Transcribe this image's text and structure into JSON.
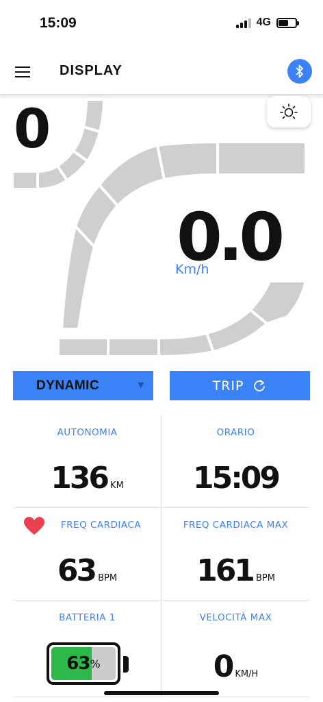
{
  "status": {
    "time": "15:09",
    "network": "4G"
  },
  "header": {
    "title": "DISPLAY"
  },
  "gauge": {
    "assist_level": "0",
    "speed": "0.0",
    "speed_unit": "Km/h"
  },
  "mode": {
    "selected": "DYNAMIC"
  },
  "trip": {
    "label": "TRIP"
  },
  "info": {
    "autonomia": {
      "label": "AUTONOMIA",
      "value": "136",
      "unit": "KM"
    },
    "orario": {
      "label": "ORARIO",
      "value": "15:09"
    },
    "freq": {
      "label": "FREQ CARDIACA",
      "value": "63",
      "unit": "BPM"
    },
    "freq_max": {
      "label": "FREQ CARDIACA MAX",
      "value": "161",
      "unit": "BPM"
    },
    "batteria": {
      "label": "BATTERIA 1",
      "value": "63",
      "unit": "%",
      "level_percent": 63
    },
    "velocita_max": {
      "label": "VELOCITÀ MAX",
      "value": "0",
      "unit": "KM/H"
    }
  },
  "colors": {
    "accent": "#3b82f6",
    "battery_fill": "#2db84a",
    "heart": "#e8404f",
    "track": "#cfcfcf"
  }
}
